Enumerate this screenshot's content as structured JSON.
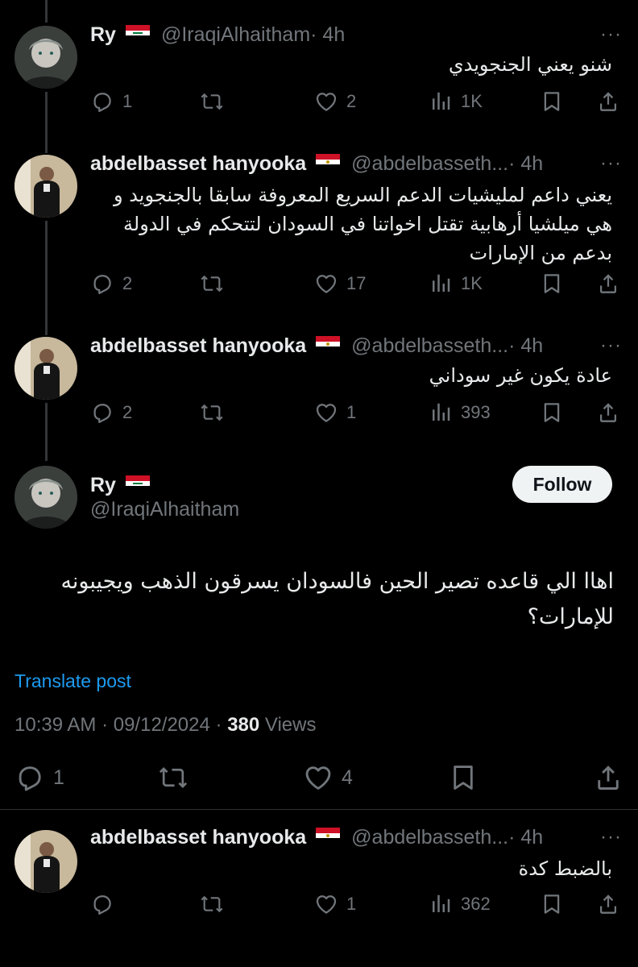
{
  "replies": [
    {
      "name": "Ry",
      "handle": "@IraqiAlhaitham",
      "time": "· 4h",
      "text": "شنو يعني الجنجويدي",
      "replies": "1",
      "reposts": "",
      "likes": "2",
      "views": "1K"
    },
    {
      "name": "abdelbasset hanyooka",
      "handle": "@abdelbasseth...",
      "time": "· 4h",
      "text": "يعني داعم لمليشيات الدعم السريع المعروفة سابقا بالجنجويد و هي ميلشيا أرهابية تقتل اخواتنا في السودان لتتحكم في الدولة بدعم من الإمارات",
      "replies": "2",
      "reposts": "",
      "likes": "17",
      "views": "1K"
    },
    {
      "name": "abdelbasset hanyooka",
      "handle": "@abdelbasseth...",
      "time": "· 4h",
      "text": "عادة يكون غير سوداني",
      "replies": "2",
      "reposts": "",
      "likes": "1",
      "views": "393"
    }
  ],
  "main": {
    "name": "Ry",
    "handle": "@IraqiAlhaitham",
    "follow_label": "Follow",
    "text": "اهاا الي قاعده تصير الحين فالسودان يسرقون الذهب ويجيبونه للإمارات؟",
    "translate": "Translate post",
    "timestamp": "10:39 AM · 09/12/2024 · ",
    "views_count": "380",
    "views_label": " Views",
    "replies": "1",
    "reposts": "",
    "likes": "4"
  },
  "last_reply": {
    "name": "abdelbasset hanyooka",
    "handle": "@abdelbasseth...",
    "time": "· 4h",
    "text": "بالضبط كدة",
    "replies": "",
    "reposts": "",
    "likes": "1",
    "views": "362"
  },
  "more_glyph": "···",
  "colors": {
    "background": "#000000",
    "text": "#e7e9ea",
    "muted": "#71767b",
    "link": "#1d9bf0",
    "line": "#333639"
  },
  "icons": [
    "reply-icon",
    "repost-icon",
    "like-icon",
    "views-icon",
    "bookmark-icon",
    "share-icon",
    "more-icon",
    "iraq-flag-icon",
    "egypt-flag-icon"
  ]
}
